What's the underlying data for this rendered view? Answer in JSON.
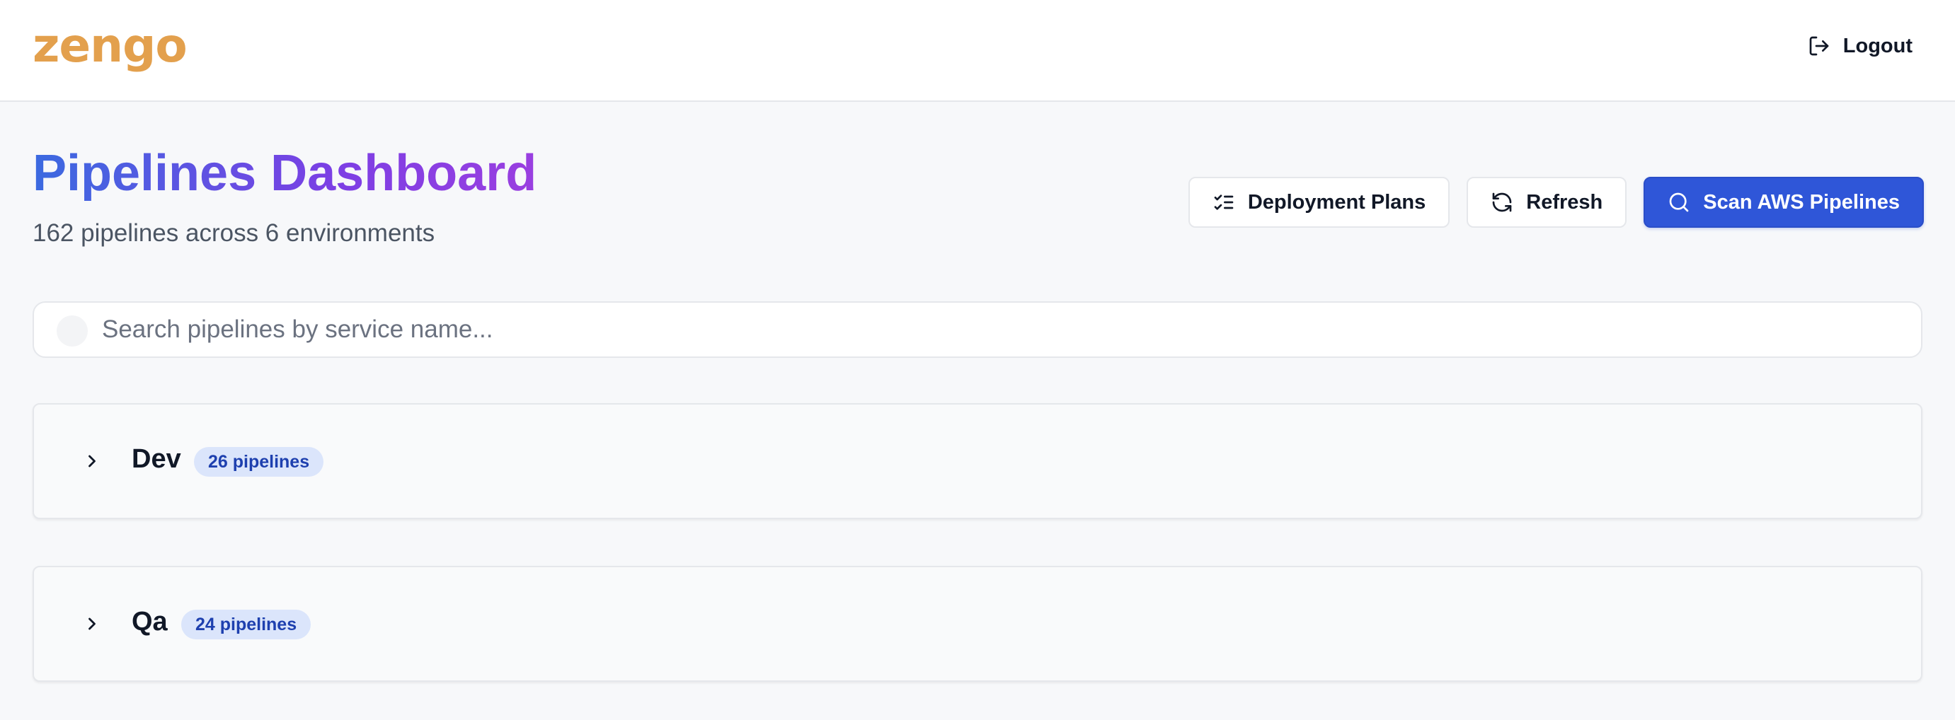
{
  "header": {
    "logo": "zengo",
    "logout_label": "Logout"
  },
  "page": {
    "title": "Pipelines Dashboard",
    "subtitle": "162 pipelines across 6 environments"
  },
  "toolbar": {
    "deployment_plans_label": "Deployment Plans",
    "refresh_label": "Refresh",
    "scan_label": "Scan AWS Pipelines"
  },
  "search": {
    "placeholder": "Search pipelines by service name...",
    "value": ""
  },
  "environments": [
    {
      "name": "Dev",
      "count_label": "26 pipelines",
      "expanded": false
    },
    {
      "name": "Qa",
      "count_label": "24 pipelines",
      "expanded": false
    }
  ],
  "colors": {
    "logo": "#e3a04d",
    "primary": "#2f56d8",
    "title_gradient_start": "#3b6ae0",
    "title_gradient_end": "#9a3fe0",
    "badge_bg": "#dbe5fb",
    "badge_text": "#1e40af"
  },
  "icons": {
    "logout": "logout-icon",
    "deployment_plans": "list-checks-icon",
    "refresh": "refresh-icon",
    "scan": "search-icon",
    "expand": "chevron-right-icon"
  }
}
